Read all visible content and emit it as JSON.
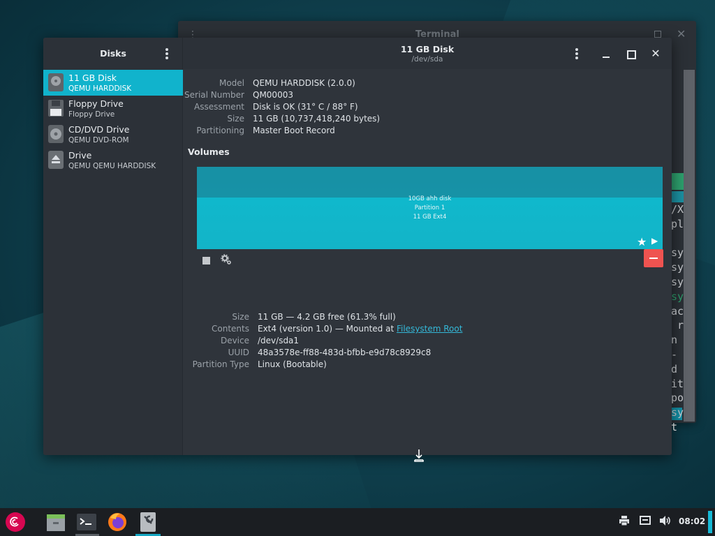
{
  "terminal": {
    "title": "Terminal",
    "visible_text": [
      "/X",
      "pl",
      "sy",
      "sy",
      "sy",
      "sy",
      "ac",
      " r",
      "n",
      "-d",
      "it",
      "po",
      "sy",
      "t"
    ]
  },
  "disks_window": {
    "sidebar": {
      "title": "Disks",
      "drives": [
        {
          "name": "11 GB Disk",
          "sub": "QEMU HARDDISK",
          "icon": "hard-disk-icon",
          "selected": true
        },
        {
          "name": "Floppy Drive",
          "sub": "Floppy Drive",
          "icon": "floppy-icon",
          "selected": false
        },
        {
          "name": "CD/DVD Drive",
          "sub": "QEMU DVD-ROM",
          "icon": "optical-drive-icon",
          "selected": false
        },
        {
          "name": "Drive",
          "sub": "QEMU QEMU HARDDISK",
          "icon": "eject-drive-icon",
          "selected": false
        }
      ]
    },
    "header": {
      "title": "11 GB Disk",
      "subtitle": "/dev/sda"
    },
    "disk_info": [
      {
        "key": "Model",
        "value": "QEMU HARDDISK (2.0.0)"
      },
      {
        "key": "Serial Number",
        "value": "QM00003"
      },
      {
        "key": "Assessment",
        "value": "Disk is OK (31° C / 88° F)"
      },
      {
        "key": "Size",
        "value": "11 GB (10,737,418,240 bytes)"
      },
      {
        "key": "Partitioning",
        "value": "Master Boot Record"
      }
    ],
    "volumes": {
      "label": "Volumes",
      "bar_lines": [
        "10GB ahh disk",
        "Partition 1",
        "11 GB Ext4"
      ]
    },
    "partition_info": [
      {
        "key": "Size",
        "value": "11 GB — 4.2 GB free (61.3% full)"
      },
      {
        "key": "Contents",
        "value": "Ext4 (version 1.0) — Mounted at ",
        "link": "Filesystem Root"
      },
      {
        "key": "Device",
        "value": "/dev/sda1"
      },
      {
        "key": "UUID",
        "value": "48a3578e-ff88-483d-bfbb-e9d78c8929c8"
      },
      {
        "key": "Partition Type",
        "value": "Linux (Bootable)"
      }
    ]
  },
  "taskbar": {
    "clock": "08:02",
    "apps": [
      "debian-menu-icon",
      "file-manager-icon",
      "terminal-icon",
      "firefox-icon",
      "disks-app-icon"
    ],
    "tray": [
      "printer-icon",
      "network-icon",
      "volume-icon"
    ],
    "colors": {
      "accent": "#16a8c4",
      "selection": "#11b3cc",
      "danger": "#ef5350"
    }
  }
}
